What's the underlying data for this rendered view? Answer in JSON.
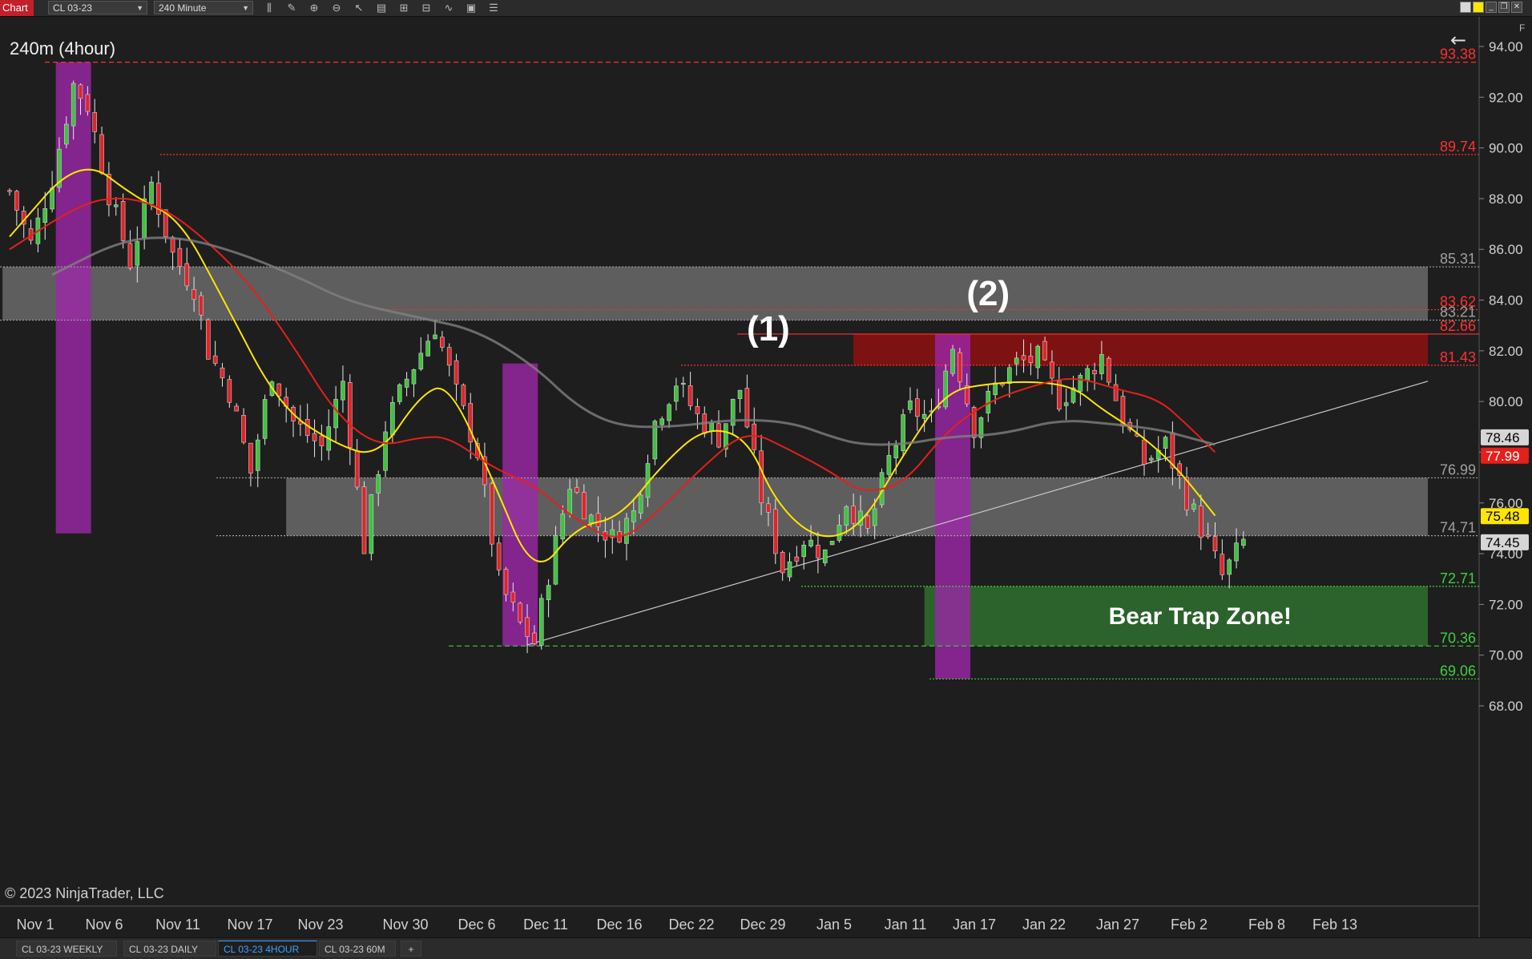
{
  "toolbar": {
    "chart_label": "Chart",
    "instrument": "CL 03-23",
    "interval": "240 Minute",
    "tool_icons": [
      "bar-style-icon",
      "draw-icon",
      "zoom-in-icon",
      "zoom-out-icon",
      "pointer-icon",
      "data-box-icon",
      "properties-icon",
      "strategy-icon",
      "indicator-icon",
      "templates-icon",
      "list-icon"
    ],
    "window_buttons": [
      "yellow-link-icon",
      "minimize-icon",
      "restore-icon",
      "close-icon"
    ]
  },
  "chart_title": "240m (4hour)",
  "copyright": "© 2023 NinjaTrader, LLC",
  "panel_label": "F",
  "bottom_tabs": [
    {
      "label": "CL 03-23 WEEKLY",
      "active": false
    },
    {
      "label": "CL 03-23 DAILY",
      "active": false
    },
    {
      "label": "CL 03-23 4HOUR",
      "active": true
    },
    {
      "label": "CL 03-23 60M",
      "active": false
    },
    {
      "label": "+",
      "active": false
    }
  ],
  "chart_data": {
    "type": "candlestick",
    "instrument": "CL 03-23",
    "interval": "240 Minute",
    "ylim": [
      66.5,
      95.0
    ],
    "yticks": [
      "94.00",
      "92.00",
      "90.00",
      "88.00",
      "86.00",
      "84.00",
      "82.00",
      "80.00",
      "78.00",
      "76.00",
      "74.00",
      "72.00",
      "70.00",
      "68.00"
    ],
    "xticks": [
      "Nov 1",
      "Nov 6",
      "Nov 11",
      "Nov 17",
      "Nov 23",
      "Nov 30",
      "Dec 6",
      "Dec 11",
      "Dec 16",
      "Dec 22",
      "Dec 29",
      "Jan 5",
      "Jan 11",
      "Jan 17",
      "Jan 22",
      "Jan 27",
      "Feb 2",
      "Feb 8",
      "Feb 13"
    ],
    "close_path": [
      [
        0,
        88.3
      ],
      [
        3,
        86.2
      ],
      [
        6,
        88.8
      ],
      [
        9,
        92.5
      ],
      [
        11,
        91.7
      ],
      [
        14,
        88.2
      ],
      [
        17,
        85.5
      ],
      [
        20,
        88.6
      ],
      [
        23,
        85.8
      ],
      [
        26,
        84.5
      ],
      [
        28,
        82.0
      ],
      [
        31,
        80.4
      ],
      [
        34,
        77.2
      ],
      [
        37,
        81.2
      ],
      [
        40,
        79.2
      ],
      [
        44,
        78.2
      ],
      [
        47,
        80.8
      ],
      [
        50,
        74.3
      ],
      [
        53,
        79.0
      ],
      [
        56,
        80.9
      ],
      [
        60,
        83.0
      ],
      [
        63,
        80.3
      ],
      [
        66,
        78.0
      ],
      [
        69,
        72.9
      ],
      [
        72,
        71.2
      ],
      [
        74,
        70.5
      ],
      [
        76,
        73.2
      ],
      [
        79,
        76.8
      ],
      [
        82,
        75.4
      ],
      [
        85,
        74.6
      ],
      [
        88,
        75.6
      ],
      [
        91,
        79.2
      ],
      [
        94,
        80.8
      ],
      [
        97,
        79.4
      ],
      [
        100,
        78.6
      ],
      [
        103,
        80.5
      ],
      [
        106,
        76.2
      ],
      [
        109,
        73.4
      ],
      [
        112,
        74.6
      ],
      [
        115,
        74.0
      ],
      [
        118,
        76.1
      ],
      [
        121,
        74.8
      ],
      [
        124,
        77.7
      ],
      [
        127,
        79.7
      ],
      [
        130,
        79.3
      ],
      [
        133,
        82.2
      ],
      [
        136,
        79.0
      ],
      [
        139,
        80.6
      ],
      [
        142,
        81.5
      ],
      [
        145,
        81.7
      ],
      [
        148,
        80.1
      ],
      [
        151,
        80.8
      ],
      [
        154,
        81.8
      ],
      [
        157,
        79.3
      ],
      [
        160,
        77.6
      ],
      [
        163,
        78.3
      ],
      [
        166,
        76.2
      ],
      [
        169,
        74.4
      ],
      [
        171,
        73.1
      ],
      [
        174,
        74.45
      ]
    ],
    "moving_averages": [
      {
        "color": "#ffe600",
        "closes_as_of": "Feb 2",
        "points": [
          [
            0,
            86.5
          ],
          [
            10,
            89.7
          ],
          [
            18,
            88.0
          ],
          [
            24,
            87.2
          ],
          [
            30,
            84.1
          ],
          [
            38,
            79.8
          ],
          [
            46,
            78.3
          ],
          [
            52,
            77.8
          ],
          [
            58,
            80.3
          ],
          [
            62,
            80.7
          ],
          [
            68,
            77.0
          ],
          [
            74,
            73.0
          ],
          [
            80,
            75.1
          ],
          [
            86,
            75.4
          ],
          [
            92,
            77.5
          ],
          [
            98,
            79.0
          ],
          [
            104,
            78.6
          ],
          [
            108,
            76.0
          ],
          [
            114,
            74.5
          ],
          [
            120,
            75.0
          ],
          [
            126,
            77.9
          ],
          [
            132,
            80.4
          ],
          [
            138,
            80.7
          ],
          [
            144,
            80.8
          ],
          [
            150,
            80.6
          ],
          [
            154,
            79.7
          ],
          [
            158,
            79.0
          ],
          [
            164,
            77.6
          ],
          [
            170,
            75.5
          ]
        ]
      },
      {
        "color": "#e5201a",
        "closes_as_of": "Feb 2",
        "points": [
          [
            0,
            86.0
          ],
          [
            10,
            87.8
          ],
          [
            16,
            88.1
          ],
          [
            22,
            87.6
          ],
          [
            28,
            86.3
          ],
          [
            34,
            84.6
          ],
          [
            40,
            82.2
          ],
          [
            46,
            79.5
          ],
          [
            52,
            78.2
          ],
          [
            58,
            78.6
          ],
          [
            62,
            78.6
          ],
          [
            68,
            77.4
          ],
          [
            74,
            76.7
          ],
          [
            80,
            75.3
          ],
          [
            86,
            74.4
          ],
          [
            92,
            75.8
          ],
          [
            98,
            77.5
          ],
          [
            104,
            78.9
          ],
          [
            110,
            78.1
          ],
          [
            116,
            77.2
          ],
          [
            120,
            76.4
          ],
          [
            126,
            76.7
          ],
          [
            132,
            78.8
          ],
          [
            138,
            80.0
          ],
          [
            144,
            80.6
          ],
          [
            150,
            81.0
          ],
          [
            156,
            80.5
          ],
          [
            162,
            80.1
          ],
          [
            166,
            79.1
          ],
          [
            170,
            78.0
          ]
        ]
      },
      {
        "color": "#7f7f7f",
        "closes_as_of": "Feb 2",
        "points": [
          [
            6,
            85.0
          ],
          [
            16,
            86.4
          ],
          [
            24,
            86.5
          ],
          [
            32,
            85.9
          ],
          [
            40,
            85.0
          ],
          [
            48,
            83.9
          ],
          [
            58,
            83.3
          ],
          [
            66,
            82.8
          ],
          [
            74,
            81.4
          ],
          [
            80,
            79.8
          ],
          [
            86,
            79.0
          ],
          [
            94,
            79.0
          ],
          [
            102,
            79.3
          ],
          [
            110,
            79.2
          ],
          [
            116,
            78.6
          ],
          [
            120,
            78.3
          ],
          [
            126,
            78.3
          ],
          [
            132,
            78.6
          ],
          [
            140,
            78.7
          ],
          [
            148,
            79.3
          ],
          [
            156,
            79.1
          ],
          [
            162,
            78.9
          ],
          [
            166,
            78.6
          ],
          [
            170,
            78.3
          ]
        ]
      }
    ],
    "levels": [
      {
        "value": 93.38,
        "label": "93.38",
        "color": "#ff3030",
        "style": "dashed"
      },
      {
        "value": 89.74,
        "label": "89.74",
        "color": "#ff3030",
        "style": "dotted"
      },
      {
        "value": 85.31,
        "label": "85.31",
        "color": "#a0a0a0",
        "style": "dotted"
      },
      {
        "value": 83.62,
        "label": "83.62",
        "color": "#ff3030",
        "style": "dotted"
      },
      {
        "value": 83.21,
        "label": "83.21",
        "color": "#a0a0a0",
        "style": "dotted"
      },
      {
        "value": 82.66,
        "label": "82.66",
        "color": "#ff3030",
        "style": "solid"
      },
      {
        "value": 81.43,
        "label": "81.43",
        "color": "#ff3030",
        "style": "dotted"
      },
      {
        "value": 76.99,
        "label": "76.99",
        "color": "#a0a0a0",
        "style": "dotted"
      },
      {
        "value": 74.71,
        "label": "74.71",
        "color": "#a0a0a0",
        "style": "dotted"
      },
      {
        "value": 72.71,
        "label": "72.71",
        "color": "#3ecf3e",
        "style": "dotted"
      },
      {
        "value": 70.36,
        "label": "70.36",
        "color": "#3ecf3e",
        "style": "dashed"
      },
      {
        "value": 69.06,
        "label": "69.06",
        "color": "#3ecf3e",
        "style": "dotted"
      }
    ],
    "zones": [
      {
        "from": 83.21,
        "to": 85.31,
        "color": "#6a6a6a",
        "x_from": -1,
        "x_to": 200
      },
      {
        "from": 74.71,
        "to": 76.99,
        "color": "#6a6a6a",
        "x_from": 39,
        "x_to": 200
      },
      {
        "from": 81.43,
        "to": 82.66,
        "color": "#8e1010",
        "x_from": 119,
        "x_to": 200
      },
      {
        "from": 70.36,
        "to": 72.71,
        "color": "#2f6e2f",
        "x_from": 129,
        "x_to": 200,
        "label": "Bear Trap Zone!"
      }
    ],
    "highlight_bars": [
      {
        "x": 9,
        "from": 74.8,
        "to": 93.38,
        "color": "#9c27a8"
      },
      {
        "x": 72,
        "from": 70.36,
        "to": 81.5,
        "color": "#9c27a8"
      },
      {
        "x": 133,
        "from": 69.06,
        "to": 82.66,
        "color": "#9c27a8"
      }
    ],
    "trendline": {
      "start": [
        73,
        70.4
      ],
      "end": [
        200,
        80.8
      ],
      "color": "#c8c8c8"
    },
    "annotations": [
      {
        "text": "(1)",
        "x": 107,
        "value": 82.4
      },
      {
        "text": "(2)",
        "x": 138,
        "value": 83.8
      }
    ],
    "price_markers": [
      {
        "label": "78.46",
        "value": 78.46,
        "bg": "#d6d6d6",
        "fg": "#000"
      },
      {
        "label": "77.99",
        "value": 77.99,
        "bg": "#e5201a",
        "fg": "#fff"
      },
      {
        "label": "75.48",
        "value": 75.48,
        "bg": "#ffe600",
        "fg": "#000"
      },
      {
        "label": "74.45",
        "value": 74.45,
        "bg": "#d6d6d6",
        "fg": "#000"
      }
    ]
  }
}
